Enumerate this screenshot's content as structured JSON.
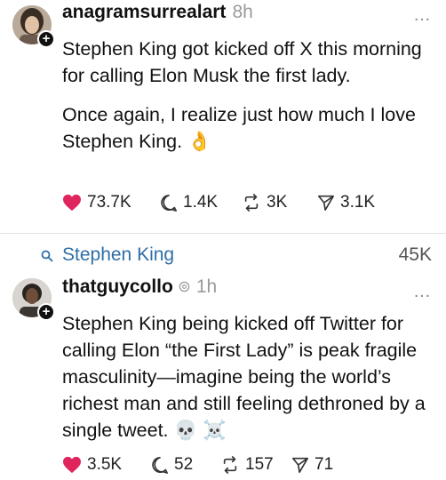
{
  "post1": {
    "username": "anagramsurrealart",
    "time": "8h",
    "more": "…",
    "paragraphs": [
      "Stephen King got kicked off X this morning for calling Elon Musk the first lady.",
      "Once again, I realize just how much I love Stephen King. 👌"
    ],
    "likes": "73.7K",
    "replies": "1.4K",
    "reposts": "3K",
    "shares": "3.1K"
  },
  "search": {
    "term": "Stephen King",
    "count": "45K"
  },
  "post2": {
    "username": "thatguycollo",
    "time": "1h",
    "more": "…",
    "paragraphs": [
      "Stephen King being kicked off Twitter for calling Elon “the First Lady” is peak fragile masculinity—imagine being the world’s richest man and still feeling dethroned by a single tweet. 💀 ☠️"
    ],
    "likes": "3.5K",
    "replies": "52",
    "reposts": "157",
    "shares": "71"
  },
  "colors": {
    "like": "#e0245e",
    "link": "#2f6ea6",
    "muted": "#9a9a9a"
  }
}
